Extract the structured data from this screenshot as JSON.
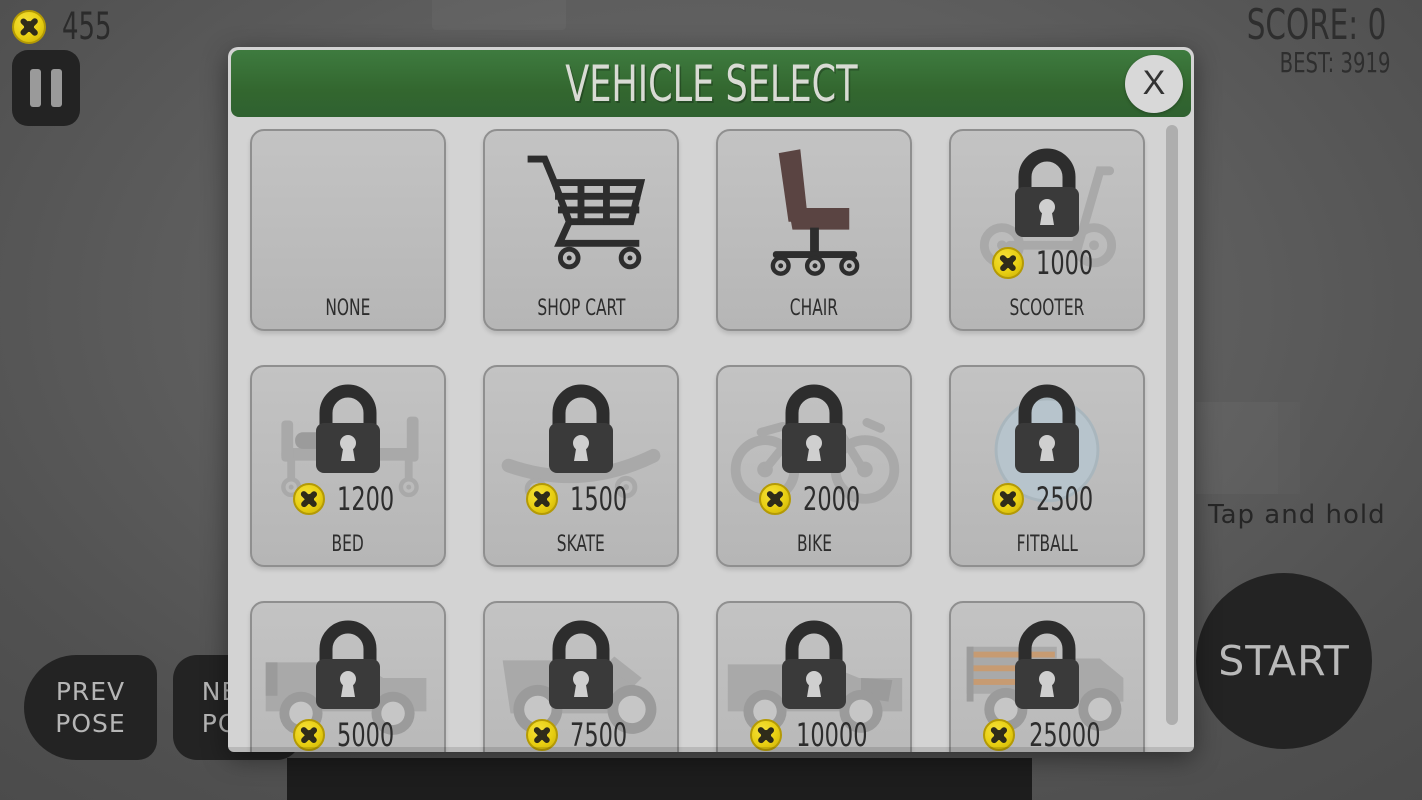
{
  "hud": {
    "coin_icon": "coin-icon",
    "coin_amount": "455",
    "pause_icon": "pause-icon",
    "score_label": "SCORE: 0",
    "best_label": "BEST: 3919"
  },
  "dialog": {
    "title": "VEHICLE SELECT",
    "close_label": "X",
    "header_color": "#336730",
    "body_color": "#d3d3d3"
  },
  "vehicles": [
    {
      "name": "NONE",
      "price": null,
      "locked": false,
      "art": "none"
    },
    {
      "name": "SHOP CART",
      "price": null,
      "locked": false,
      "art": "cart"
    },
    {
      "name": "CHAIR",
      "price": null,
      "locked": false,
      "art": "chair"
    },
    {
      "name": "SCOOTER",
      "price": "1000",
      "locked": true,
      "art": "scooter"
    },
    {
      "name": "BED",
      "price": "1200",
      "locked": true,
      "art": "bed"
    },
    {
      "name": "SKATE",
      "price": "1500",
      "locked": true,
      "art": "skate"
    },
    {
      "name": "BIKE",
      "price": "2000",
      "locked": true,
      "art": "bike"
    },
    {
      "name": "FITBALL",
      "price": "2500",
      "locked": true,
      "art": "fitball"
    },
    {
      "name": "",
      "price": "5000",
      "locked": true,
      "art": "pickup"
    },
    {
      "name": "",
      "price": "7500",
      "locked": true,
      "art": "buggy"
    },
    {
      "name": "",
      "price": "10000",
      "locked": true,
      "art": "car"
    },
    {
      "name": "",
      "price": "25000",
      "locked": true,
      "art": "truck"
    }
  ],
  "controls": {
    "prev_pose_line1": "PREV",
    "prev_pose_line2": "POSE",
    "next_pose_line1": "NEXT",
    "next_pose_line2": "POSE",
    "tap_and_hold": "Tap and hold",
    "start_label": "START"
  },
  "colors": {
    "coin_yellow": "#e8cf12",
    "green_header": "#336730",
    "dark_ui": "#232323",
    "card_gray": "#b9b9b9"
  }
}
